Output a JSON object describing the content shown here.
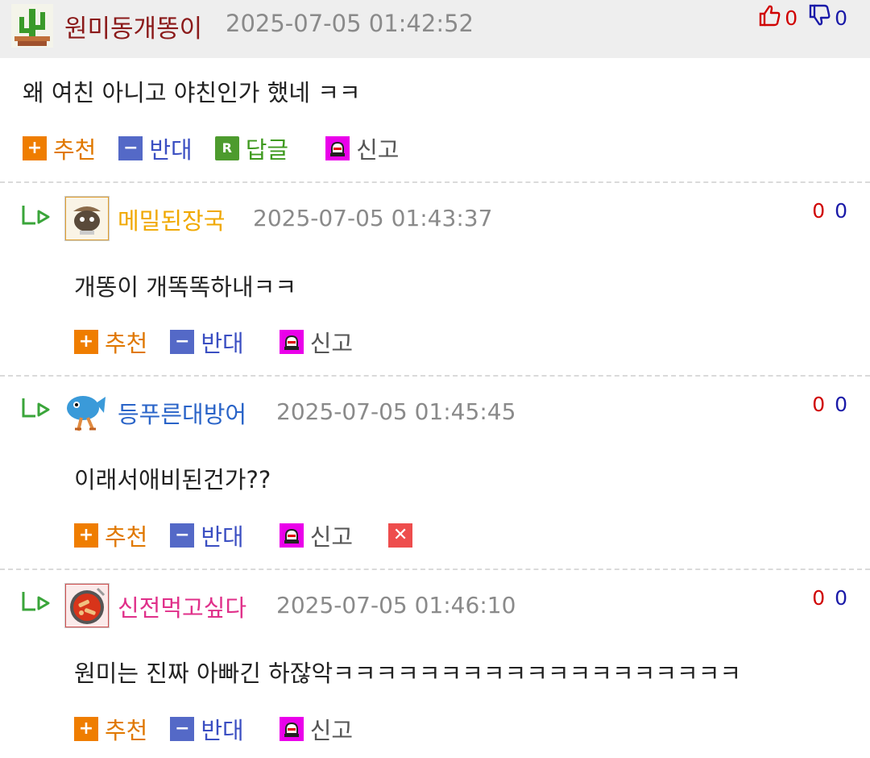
{
  "main_comment": {
    "nickname": "원미동개똥이",
    "timestamp": "2025-07-05 01:42:52",
    "likes": "0",
    "dislikes": "0",
    "text": "왜 여친 아니고 야친인가 했네 ㅋㅋ",
    "actions": {
      "recommend": "추천",
      "oppose": "반대",
      "reply": "답글",
      "report": "신고"
    }
  },
  "replies": [
    {
      "nickname": "메밀된장국",
      "nick_color": "#f0a800",
      "timestamp": "2025-07-05 01:43:37",
      "likes": "0",
      "dislikes": "0",
      "text": "개똥이 개똑똑하내ㅋㅋ",
      "actions": {
        "recommend": "추천",
        "oppose": "반대",
        "report": "신고"
      }
    },
    {
      "nickname": "등푸른대방어",
      "nick_color": "#2a64c8",
      "timestamp": "2025-07-05 01:45:45",
      "likes": "0",
      "dislikes": "0",
      "text": "이래서애비된건가??",
      "actions": {
        "recommend": "추천",
        "oppose": "반대",
        "report": "신고"
      }
    },
    {
      "nickname": "신전먹고싶다",
      "nick_color": "#e0308a",
      "timestamp": "2025-07-05 01:46:10",
      "likes": "0",
      "dislikes": "0",
      "text": "원미는 진짜 아빠긴 하잖악ㅋㅋㅋㅋㅋㅋㅋㅋㅋㅋㅋㅋㅋㅋㅋㅋㅋㅋㅋ",
      "actions": {
        "recommend": "추천",
        "oppose": "반대",
        "report": "신고"
      }
    }
  ],
  "icons": {
    "like": "thumbs-up-icon",
    "dislike": "thumbs-down-icon",
    "reply_marker": "reply-arrow-icon",
    "report": "siren-icon",
    "delete": "close-icon"
  },
  "colors": {
    "recommend": "#ef7d00",
    "oppose": "#5469c7",
    "reply": "#4d9b2e",
    "report": "#ea00ea",
    "like_count": "#d00000",
    "dislike_count": "#1a1aa8"
  }
}
